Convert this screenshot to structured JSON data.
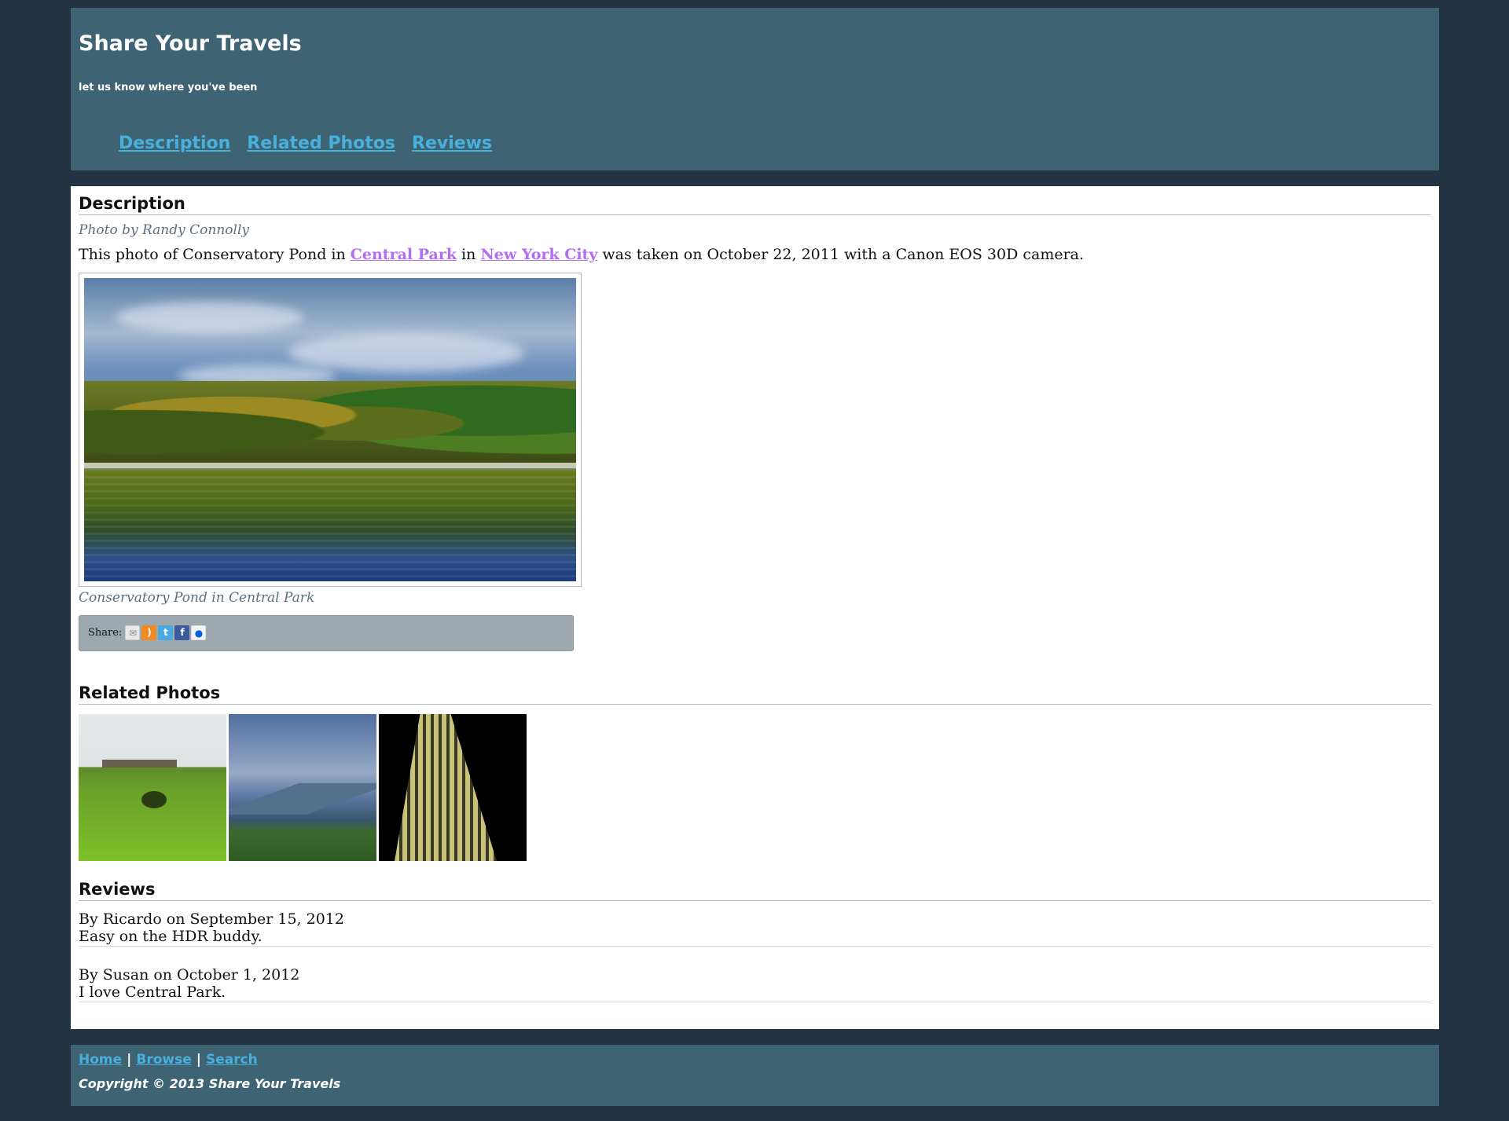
{
  "header": {
    "title": "Share Your Travels",
    "tagline": "let us know where you've been",
    "nav": [
      "Description",
      "Related Photos",
      "Reviews"
    ]
  },
  "description": {
    "heading": "Description",
    "byline": "Photo by Randy Connolly",
    "text_before": "This photo of Conservatory Pond in ",
    "link1": "Central Park",
    "text_mid": " in ",
    "link2": "New York City",
    "text_after": " was taken on October 22, 2011 with a Canon EOS 30D camera.",
    "caption": "Conservatory Pond in Central Park",
    "share_label": "Share:",
    "share_icons": [
      "email-icon",
      "rss-icon",
      "twitter-icon",
      "facebook-icon",
      "flickr-icon"
    ]
  },
  "related": {
    "heading": "Related Photos"
  },
  "reviews": {
    "heading": "Reviews",
    "items": [
      {
        "meta": "By Ricardo on September 15, 2012",
        "text": "Easy on the HDR buddy."
      },
      {
        "meta": "By Susan on October 1, 2012",
        "text": "I love Central Park."
      }
    ]
  },
  "footer": {
    "links": [
      "Home",
      "Browse",
      "Search"
    ],
    "separator": "|",
    "copyright": "Copyright © 2013 Share Your Travels"
  },
  "colors": {
    "page_bg": "#223444",
    "panel_bg": "#3e6373",
    "link": "#47b0dd",
    "visited_link": "#b26ef0"
  }
}
